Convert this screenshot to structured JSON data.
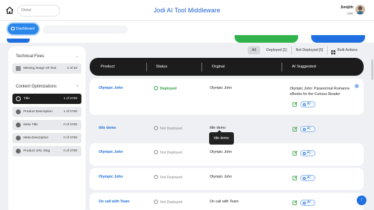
{
  "header": {
    "store_select": "Dixtut",
    "app_title": "Jodi AI Tool Middleware",
    "user_name": "Smijith",
    "user_role": "User"
  },
  "nav": {
    "dashboard_label": "Dashboard"
  },
  "sidebar": {
    "section1_title": "Technical Fixes",
    "section1_items": [
      {
        "label": "Missing image Alt Text",
        "count": "1 of 22"
      }
    ],
    "section2_title": "Content Optimizations",
    "section2_items": [
      {
        "label": "Title",
        "count": "1 of 2700"
      },
      {
        "label": "Product Description",
        "count": "1 of 2700"
      },
      {
        "label": "Meta Title",
        "count": "0 of 2700"
      },
      {
        "label": "Meta Description",
        "count": "0 of 2700"
      },
      {
        "label": "Product URL Slug",
        "count": "0 of 2700"
      }
    ]
  },
  "filters": {
    "all": "All",
    "deployed": "Deployed [1]",
    "not_deployed": "Not Deployed [0]",
    "bulk": "Bulk Actions"
  },
  "table": {
    "headers": [
      "Product",
      "Status",
      "Orginal",
      "AI Suggested"
    ],
    "ai_label": "AI",
    "rows": [
      {
        "product": "Olympic John",
        "status": "Deployed",
        "original": "Olympic John",
        "suggested": "Olympic John: Paranormal Romance eBooks for the Curious Reader"
      },
      {
        "product": "title demo",
        "status": "Not Deployed",
        "original": "title demo",
        "suggested": ""
      },
      {
        "product": "Olympic John",
        "status": "Not Deployed",
        "original": "Olympic John",
        "suggested": ""
      },
      {
        "product": "Olympic John",
        "status": "Not Deployed",
        "original": "Olympic John",
        "suggested": ""
      },
      {
        "product": "On call with Team",
        "status": "Not Deployed",
        "original": "On call with Team",
        "suggested": ""
      }
    ],
    "tooltip": "title demo"
  },
  "colors": {
    "accent": "#1f6fe0",
    "deployed": "#2c9a43",
    "header_dark": "#1c1c1c"
  }
}
